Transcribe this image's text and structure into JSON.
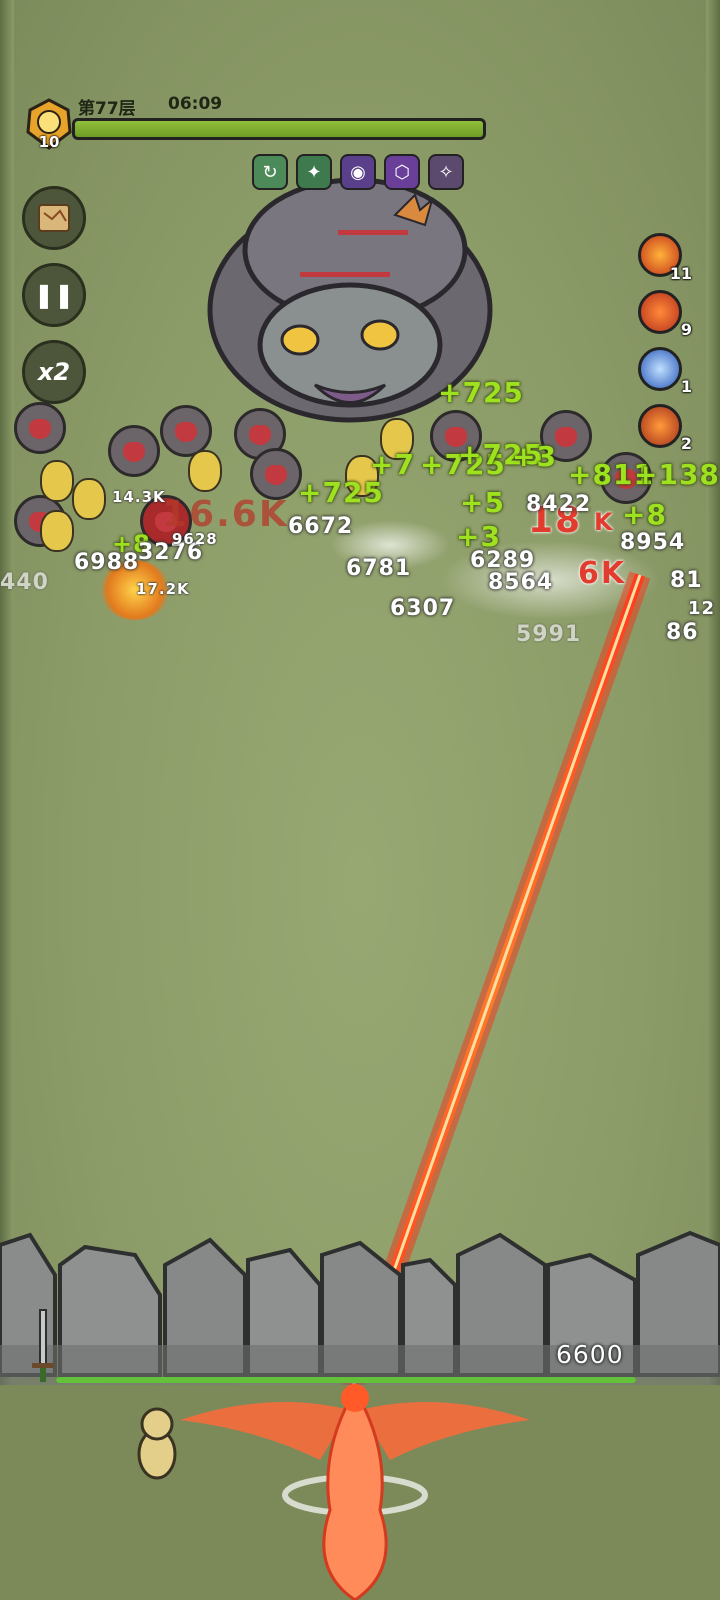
{
  "hud": {
    "level": "10",
    "floor": "第77层",
    "timer": "06:09",
    "boss_hp_percent": 100,
    "buff_icons": [
      "swirl-buff-icon",
      "spirit-buff-icon",
      "arcane-buff-icon",
      "shield-buff-icon",
      "claw-buff-icon"
    ]
  },
  "side_buttons": {
    "map": "map-scroll-icon",
    "pause": "❚❚",
    "speed": "x2"
  },
  "skills": [
    {
      "name": "fire-meteor-skill-icon",
      "count": "11",
      "color": "#d6431c"
    },
    {
      "name": "flame-sword-skill-icon",
      "count": "9",
      "color": "#c93a22"
    },
    {
      "name": "ice-orb-skill-icon",
      "count": "1",
      "color": "#3a66c8"
    },
    {
      "name": "fire-pillar-skill-icon",
      "count": "2",
      "color": "#b8361f"
    }
  ],
  "damage_numbers": {
    "white": [
      "6672",
      "6781",
      "6307",
      "6988",
      "3276",
      "8954",
      "8422",
      "6289",
      "8564",
      "440",
      "81",
      "12"
    ],
    "small": [
      "14.3K",
      "17.2K",
      "9628"
    ],
    "green": [
      "+725",
      "+7",
      "+725",
      "+725",
      "+725",
      "+3",
      "+5",
      "+3",
      "+8",
      "+811",
      "+138",
      "+8"
    ],
    "red": [
      "18",
      "K",
      "16.6K",
      "6K"
    ],
    "grey": [
      "5991",
      "86"
    ]
  },
  "wall": {
    "hp_text": "6600",
    "hp_percent": 100
  },
  "colors": {
    "grass": "#8c9c68",
    "boss_bar": "#8fbf3a",
    "laser": "#ff5a28",
    "wall_hp": "#64c23a"
  }
}
